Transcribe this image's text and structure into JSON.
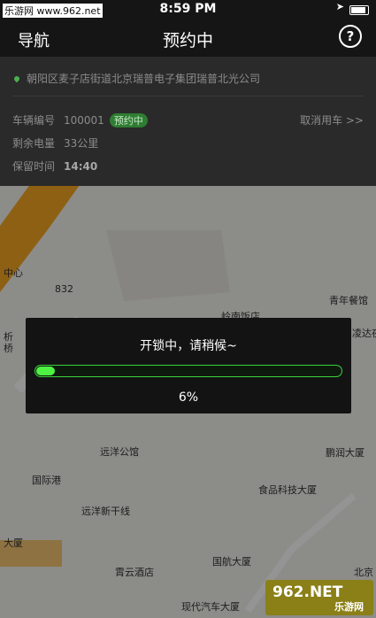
{
  "status_bar": {
    "watermark_text": "乐游网 www.962.net",
    "time": "8:59 PM",
    "location_arrow": "➤"
  },
  "nav": {
    "left_label": "导航",
    "title": "预约中",
    "help_glyph": "?"
  },
  "info": {
    "address": "朝阳区麦子店街道北京瑞普电子集团瑞普北光公司",
    "vehicle_label": "车辆编号",
    "vehicle_value": "100001",
    "status_badge": "预约中",
    "battery_label": "剩余电量",
    "battery_value": "33公里",
    "time_label": "保留时间",
    "time_value": "14:40",
    "cancel_label": "取消用车 >>"
  },
  "map_labels": [
    "中心",
    "832",
    "岭南饭店",
    "青年餐馆",
    "析",
    "桥",
    "凌达夜",
    "远洋公馆",
    "鹏润大厦",
    "国际港",
    "食品科技大厦",
    "远洋新干线",
    "大厦",
    "霄云酒店",
    "国航大厦",
    "北京",
    "现代汽车大厦"
  ],
  "dialog": {
    "message": "开锁中，请稍候~",
    "progress": 0.06,
    "progress_text": "6%"
  },
  "corner_logo": {
    "main": "962.NET",
    "sub": "乐游网"
  },
  "colors": {
    "accent_green": "#4df243",
    "bar_bg": "#151515",
    "info_bg": "#2a2a2a"
  }
}
